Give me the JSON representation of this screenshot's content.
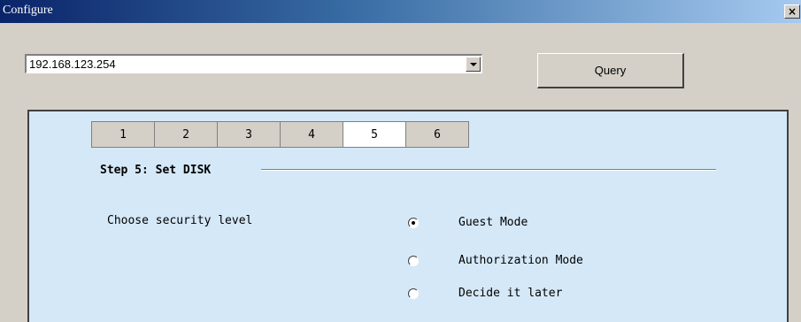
{
  "window": {
    "title": "Configure",
    "close_glyph": "×",
    "icons": {
      "close": "close-icon"
    }
  },
  "host": {
    "selected": "192.168.123.254",
    "dropdown_icon": "chevron-down-icon"
  },
  "query_button": {
    "label": "Query"
  },
  "wizard": {
    "tabs": [
      {
        "label": "1",
        "active": false
      },
      {
        "label": "2",
        "active": false
      },
      {
        "label": "3",
        "active": false
      },
      {
        "label": "4",
        "active": false
      },
      {
        "label": "5",
        "active": true
      },
      {
        "label": "6",
        "active": false
      }
    ],
    "step_title": "Step 5: Set DISK",
    "security_label": "Choose security level",
    "options": [
      {
        "label": "Guest Mode",
        "selected": true
      },
      {
        "label": "Authorization Mode",
        "selected": false
      },
      {
        "label": "Decide it later",
        "selected": false
      }
    ]
  },
  "colors": {
    "panel_bg": "#d5e8f8",
    "dialog_bg": "#d4d0c8",
    "titlebar_start": "#0a246a",
    "titlebar_end": "#a6caf0"
  }
}
